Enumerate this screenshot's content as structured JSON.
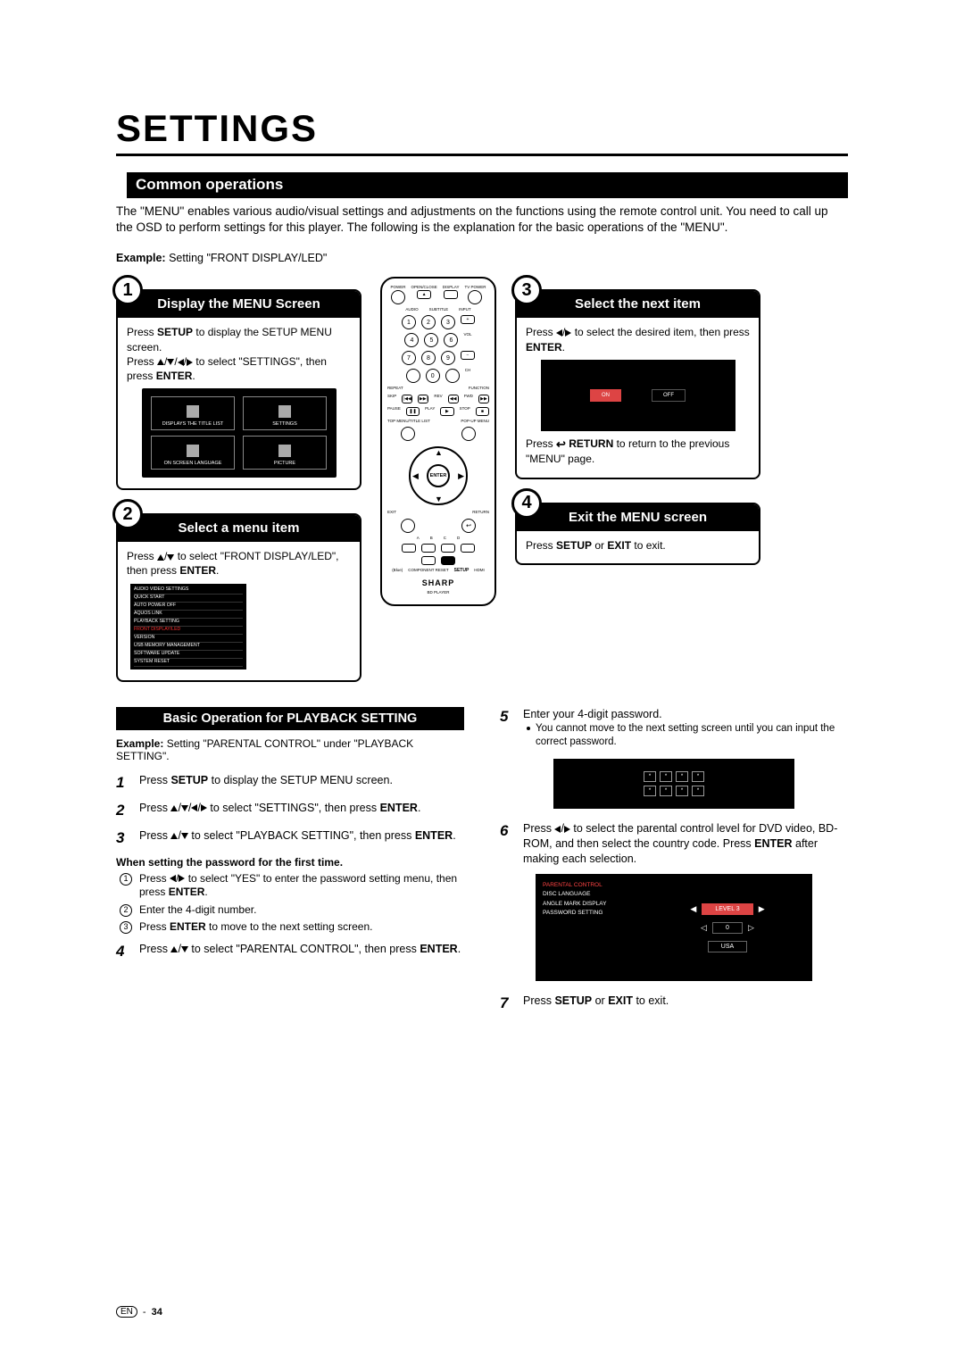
{
  "title": "SETTINGS",
  "section": "Common operations",
  "intro": "The \"MENU\" enables various audio/visual settings and adjustments on the functions using the remote control unit. You need to call up the OSD to perform settings for this player. The following is the explanation for the basic operations of the \"MENU\".",
  "example_label": "Example:",
  "example_text": " Setting \"FRONT DISPLAY/LED\"",
  "steps": {
    "s1": {
      "num": "1",
      "title": "Display the MENU Screen",
      "line1a": "Press ",
      "line1b": "SETUP",
      "line1c": " to display the SETUP MENU screen.",
      "line2a": "Press ",
      "line2b": " to select \"SETTINGS\", then press ",
      "line2c": "ENTER",
      "line2d": ".",
      "tiles": [
        "DISPLAYS THE TITLE LIST",
        "SETTINGS",
        "ON SCREEN LANGUAGE",
        "PICTURE"
      ]
    },
    "s2": {
      "num": "2",
      "title": "Select a menu item",
      "line1a": "Press ",
      "line1b": " to select \"FRONT DISPLAY/LED\", then press ",
      "line1c": "ENTER",
      "line1d": ".",
      "menu": [
        "AUDIO VIDEO SETTINGS",
        "QUICK START",
        "AUTO POWER OFF",
        "AQUOS LINK",
        "PLAYBACK SETTING",
        "FRONT DISPLAY/LED",
        "VERSION",
        "USB MEMORY MANAGEMENT",
        "SOFTWARE UPDATE",
        "SYSTEM RESET"
      ]
    },
    "s3": {
      "num": "3",
      "title": "Select the next item",
      "line1a": "Press ",
      "line1b": " to select the desired item, then press ",
      "line1c": "ENTER",
      "line1d": ".",
      "on": "ON",
      "off": "OFF",
      "line2a": "Press ",
      "line2b": "RETURN",
      "line2c": " to return to the previous \"MENU\" page."
    },
    "s4": {
      "num": "4",
      "title": "Exit the MENU screen",
      "line1a": "Press ",
      "line1b": "SETUP",
      "line1c": " or ",
      "line1d": "EXIT",
      "line1e": " to exit."
    }
  },
  "remote": {
    "top_labels": [
      "POWER",
      "OPEN/CLOSE",
      "DISPLAY",
      "TV POWER"
    ],
    "row2": [
      "AUDIO",
      "SUBTITLE",
      "INPUT"
    ],
    "nums": [
      "1",
      "2",
      "3",
      "4",
      "5",
      "6",
      "7",
      "8",
      "9",
      "0"
    ],
    "vol": "VOL",
    "ch": "CH",
    "repeat": "REPEAT",
    "function": "FUNCTION",
    "skip": "SKIP",
    "rev": "REV",
    "fwd": "FWD",
    "pause": "PAUSE",
    "play": "PLAY",
    "stop": "STOP",
    "topmenu": "TOP MENU/TITLE LIST",
    "popup": "POP-UP MENU",
    "enter": "ENTER",
    "exit": "EXIT",
    "return": "RETURN",
    "abcd": [
      "A",
      "B",
      "C",
      "D"
    ],
    "bottom": [
      "(Blue)",
      "COMPONENT RESET",
      "SETUP",
      "HDMI"
    ],
    "brand": "SHARP",
    "model": "BD PLAYER"
  },
  "basic": {
    "header": "Basic Operation for PLAYBACK SETTING",
    "ex_label": "Example:",
    "ex_text": " Setting \"PARENTAL CONTROL\" under \"PLAYBACK SETTING\".",
    "s1": {
      "n": "1",
      "a": "Press ",
      "b": "SETUP",
      "c": " to display the SETUP MENU screen."
    },
    "s2": {
      "n": "2",
      "a": "Press ",
      "b": " to select \"SETTINGS\", then press ",
      "c": "ENTER",
      "d": "."
    },
    "s3": {
      "n": "3",
      "a": "Press ",
      "b": " to select \"PLAYBACK SETTING\", then press ",
      "c": "ENTER",
      "d": "."
    },
    "note": "When setting the password for the first time.",
    "e1": {
      "n": "1",
      "a": "Press ",
      "b": " to select \"YES\" to enter the password setting menu, then press ",
      "c": "ENTER",
      "d": "."
    },
    "e2": {
      "n": "2",
      "t": "Enter the 4-digit number."
    },
    "e3": {
      "n": "3",
      "a": "Press ",
      "b": "ENTER",
      "c": " to move to the next setting screen."
    },
    "s4": {
      "n": "4",
      "a": "Press ",
      "b": " to select \"PARENTAL CONTROL\", then press ",
      "c": "ENTER",
      "d": "."
    },
    "s5": {
      "n": "5",
      "t": "Enter your 4-digit password.",
      "bul": "You cannot move to the next setting screen until you can input the correct password."
    },
    "s6": {
      "n": "6",
      "a": "Press ",
      "b": " to select the parental control level for DVD video, BD-ROM, and then select the country code. Press ",
      "c": "ENTER",
      "d": " after making each selection."
    },
    "pc_menu": [
      "PARENTAL CONTROL",
      "DISC LANGUAGE",
      "ANGLE MARK DISPLAY",
      "PASSWORD SETTING"
    ],
    "pc_vals": [
      "LEVEL 3",
      "0",
      "USA"
    ],
    "s7": {
      "n": "7",
      "a": "Press ",
      "b": "SETUP",
      "c": " or ",
      "d": "EXIT",
      "e": " to exit."
    }
  },
  "footer": {
    "lang": "EN",
    "page": "34"
  }
}
